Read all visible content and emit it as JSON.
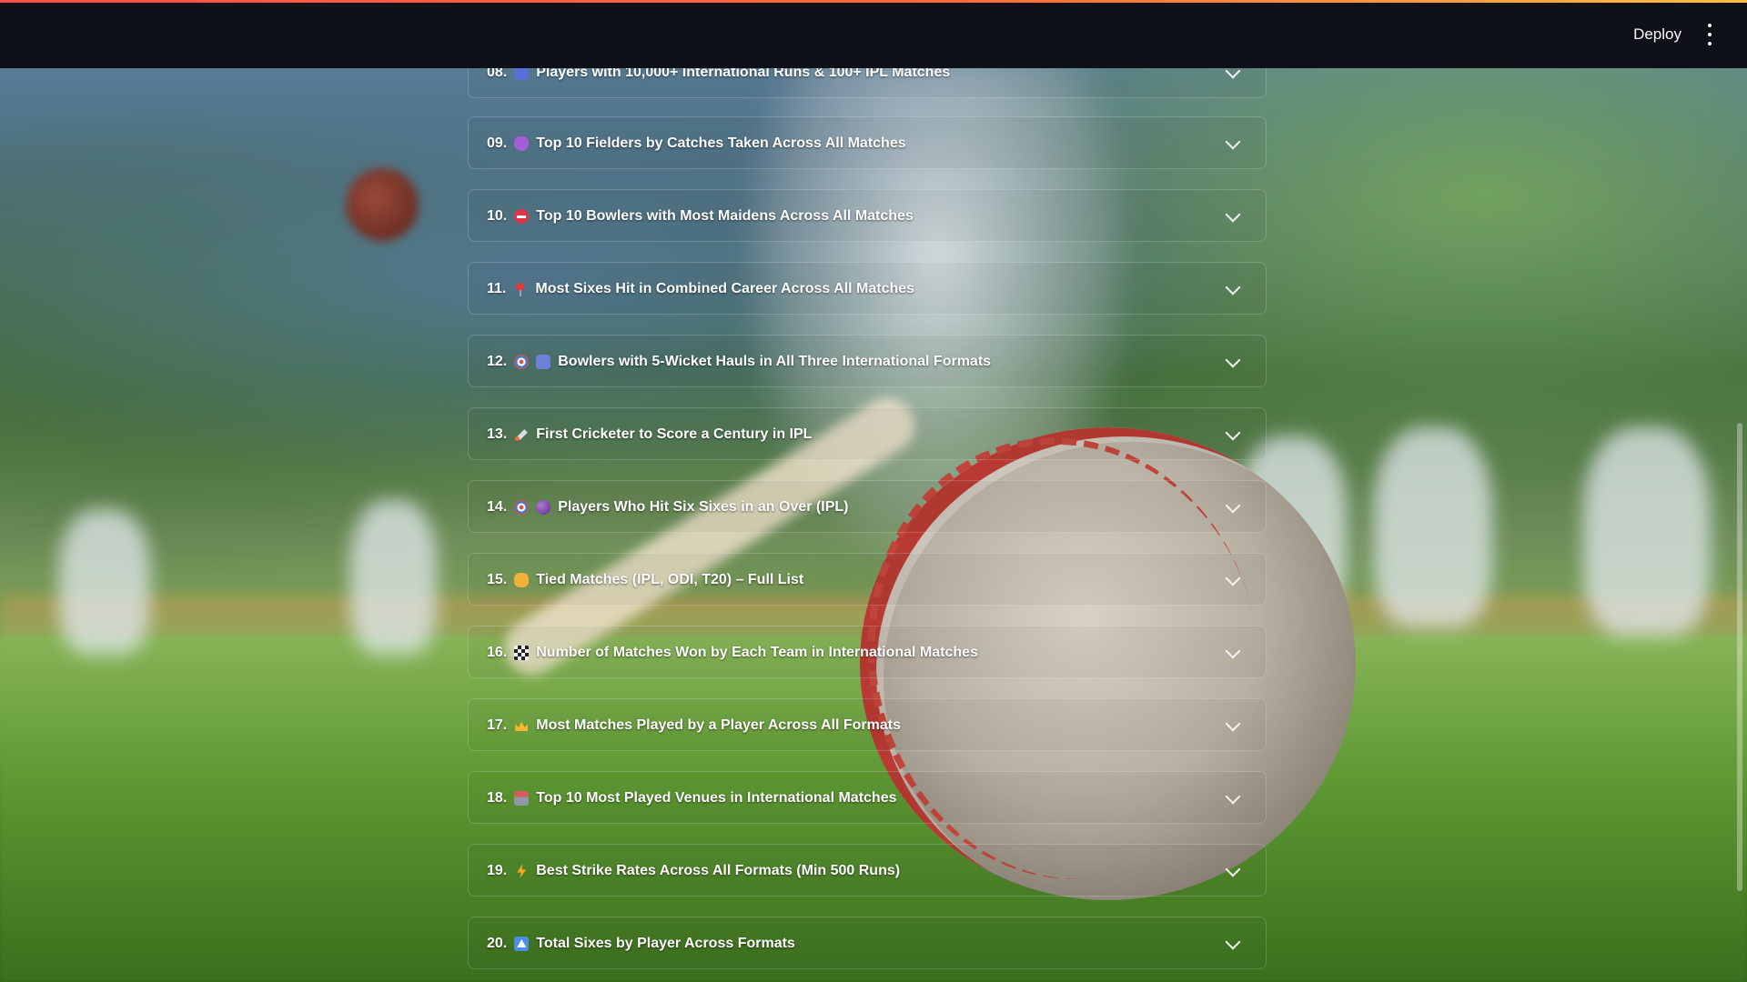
{
  "header": {
    "deploy_label": "Deploy"
  },
  "expanders": [
    {
      "num": "08.",
      "emoji": "people-icon",
      "title": "Players with 10,000+ International Runs & 100+ IPL Matches"
    },
    {
      "num": "09.",
      "emoji": "hand-icon",
      "title": "Top 10 Fielders by Catches Taken Across All Matches"
    },
    {
      "num": "10.",
      "emoji": "no-entry-icon",
      "title": "Top 10 Bowlers with Most Maidens Across All Matches"
    },
    {
      "num": "11.",
      "emoji": "pin-icon",
      "title": "Most Sixes Hit in Combined Career Across All Matches"
    },
    {
      "num": "12.",
      "emoji": "target-icon",
      "emoji2": "people-icon",
      "title": "Bowlers with 5-Wicket Hauls in All Three International Formats"
    },
    {
      "num": "13.",
      "emoji": "rocket-icon",
      "title": "First Cricketer to Score a Century in IPL"
    },
    {
      "num": "14.",
      "emoji": "target-icon",
      "emoji2": "ball-icon",
      "title": "Players Who Hit Six Sixes in an Over (IPL)"
    },
    {
      "num": "15.",
      "emoji": "handshake-icon",
      "title": "Tied Matches (IPL, ODI, T20) – Full List"
    },
    {
      "num": "16.",
      "emoji": "checkered-flag-icon",
      "title": "Number of Matches Won by Each Team in International Matches"
    },
    {
      "num": "17.",
      "emoji": "crown-icon",
      "title": "Most Matches Played by a Player Across All Formats"
    },
    {
      "num": "18.",
      "emoji": "stadium-icon",
      "title": "Top 10 Most Played Venues in International Matches"
    },
    {
      "num": "19.",
      "emoji": "lightning-icon",
      "title": "Best Strike Rates Across All Formats (Min 500 Runs)"
    },
    {
      "num": "20.",
      "emoji": "up-arrow-icon",
      "title": "Total Sixes by Player Across Formats"
    }
  ]
}
